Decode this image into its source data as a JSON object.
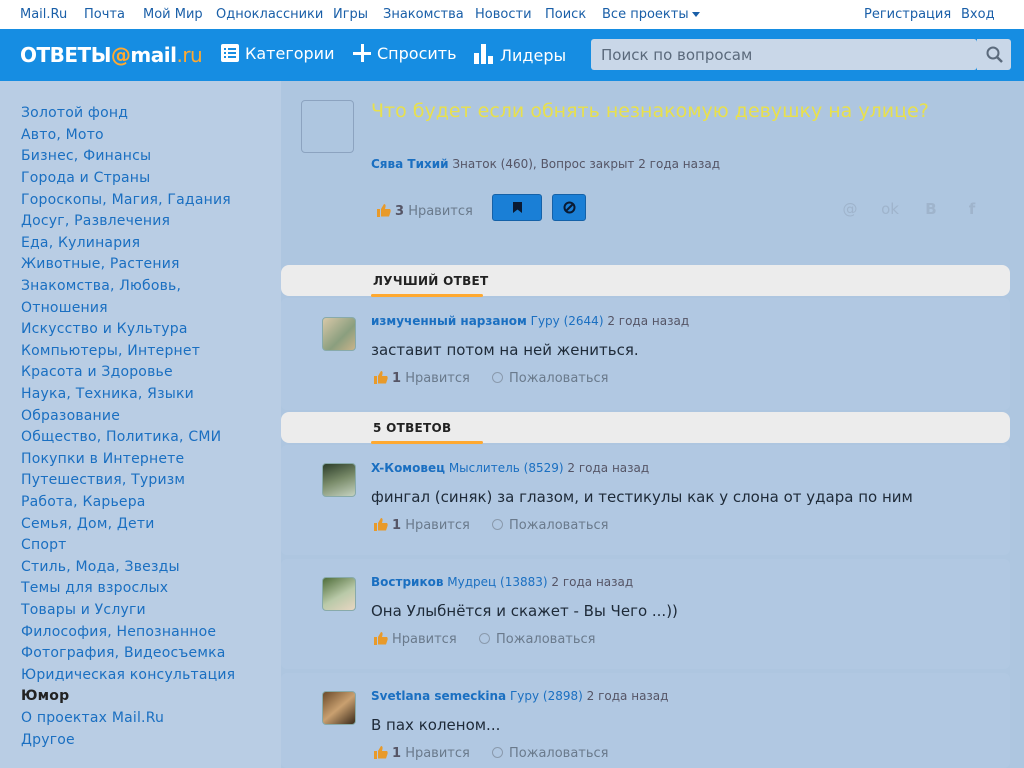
{
  "portal": {
    "links": [
      "Mail.Ru",
      "Почта",
      "Мой Мир",
      "Одноклассники",
      "Игры",
      "Знакомства",
      "Новости",
      "Поиск",
      "Все проекты"
    ],
    "register": "Регистрация",
    "login": "Вход"
  },
  "header": {
    "logo_text": "ОТВЕТЫ",
    "logo_at": "@",
    "logo_mail": "mail",
    "logo_ru": ".ru",
    "nav": [
      "Категории",
      "Спросить",
      "Лидеры"
    ],
    "search_placeholder": "Поиск по вопросам"
  },
  "sidebar": {
    "categories": [
      "Золотой фонд",
      "Авто, Мото",
      "Бизнес, Финансы",
      "Города и Страны",
      "Гороскопы, Магия, Гадания",
      "Досуг, Развлечения",
      "Еда, Кулинария",
      "Животные, Растения",
      "Знакомства, Любовь,",
      "Отношения",
      "Искусство и Культура",
      "Компьютеры, Интернет",
      "Красота и Здоровье",
      "Наука, Техника, Языки",
      "Образование",
      "Общество, Политика, СМИ",
      "Покупки в Интернете",
      "Путешествия, Туризм",
      "Работа, Карьера",
      "Семья, Дом, Дети",
      "Спорт",
      "Стиль, Мода, Звезды",
      "Темы для взрослых",
      "Товары и Услуги",
      "Философия, Непознанное",
      "Фотография, Видеосъемка",
      "Юридическая консультация",
      "Юмор",
      "О проектах Mail.Ru",
      "Другое"
    ],
    "active": "Юмор"
  },
  "question": {
    "title": "Что будет если обнять незнакомую девушку на улице?",
    "author": "Сява Тихий",
    "rank": "Знаток (460),",
    "status": "Вопрос закрыт 2 года назад",
    "likes": "3",
    "like_label": "Нравится"
  },
  "best_answer": {
    "section_label": "ЛУЧШИЙ ОТВЕТ",
    "author": "измученный нарзаном",
    "rank": "Гуру (2644)",
    "time": "2 года назад",
    "text": "заставит потом на ней жениться.",
    "likes": "1",
    "like_label": "Нравится",
    "report_label": "Пожаловаться"
  },
  "answers_section_label": "5 ОТВЕТОВ",
  "answers": [
    {
      "author": "X-Комовец",
      "rank": "Мыслитель (8529)",
      "time": "2 года назад",
      "text": "фингал (синяк) за глазом, и тестикулы как у слона от удара по ним",
      "likes": "1",
      "like_label": "Нравится",
      "report_label": "Пожаловаться"
    },
    {
      "author": "Востриков",
      "rank": "Мудрец (13883)",
      "time": "2 года назад",
      "text": "Она Улыбнётся и скажет - Вы Чего ...))",
      "likes": "",
      "like_label": "Нравится",
      "report_label": "Пожаловаться"
    },
    {
      "author": "Svetlana semeckina",
      "rank": "Гуру (2898)",
      "time": "2 года назад",
      "text": "В пах коленом...",
      "likes": "1",
      "like_label": "Нравится",
      "report_label": "Пожаловаться"
    }
  ],
  "colors": {
    "header_blue": "#168de2",
    "accent_orange": "#ffa930",
    "title_yellow": "#e8e04d",
    "link_blue": "#1a6fc1"
  }
}
